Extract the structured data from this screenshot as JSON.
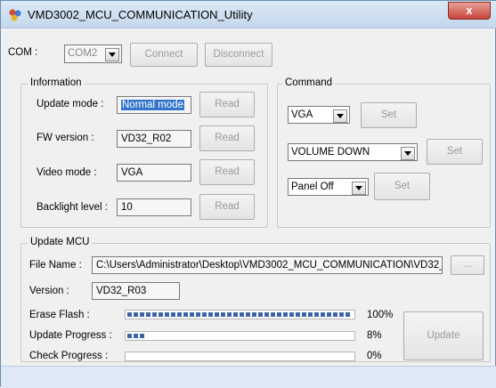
{
  "window": {
    "title": "VMD3002_MCU_COMMUNICATION_Utility",
    "close_glyph": "x"
  },
  "com": {
    "label": "COM :",
    "port_value": "COM2",
    "connect_label": "Connect",
    "disconnect_label": "Disconnect"
  },
  "information": {
    "legend": "Information",
    "rows": [
      {
        "label": "Update mode :",
        "value": "Normal mode",
        "button": "Read"
      },
      {
        "label": "FW version :",
        "value": "VD32_R02",
        "button": "Read"
      },
      {
        "label": "Video mode :",
        "value": "VGA",
        "button": "Read"
      },
      {
        "label": "Backlight level :",
        "value": "10",
        "button": "Read"
      }
    ]
  },
  "command": {
    "legend": "Command",
    "rows": [
      {
        "value": "VGA",
        "button": "Set"
      },
      {
        "value": "VOLUME DOWN",
        "button": "Set"
      },
      {
        "value": "Panel Off",
        "button": "Set"
      }
    ]
  },
  "update_mcu": {
    "legend": "Update MCU",
    "file_label": "File Name :",
    "file_value": "C:\\Users\\Administrator\\Desktop\\VMD3002_MCU_COMMUNICATION\\VD32_",
    "browse_label": "...",
    "version_label": "Version :",
    "version_value": "VD32_R03",
    "progress": [
      {
        "label": "Erase Flash :",
        "percent_text": "100%",
        "fraction": 1.0
      },
      {
        "label": "Update Progress :",
        "percent_text": "8%",
        "fraction": 0.08
      },
      {
        "label": "Check Progress :",
        "percent_text": "0%",
        "fraction": 0.0
      }
    ],
    "update_button": "Update"
  },
  "colors": {
    "progress_fill": "#3c64a8",
    "close_button": "#c7433a",
    "highlight": "#3377cc"
  }
}
